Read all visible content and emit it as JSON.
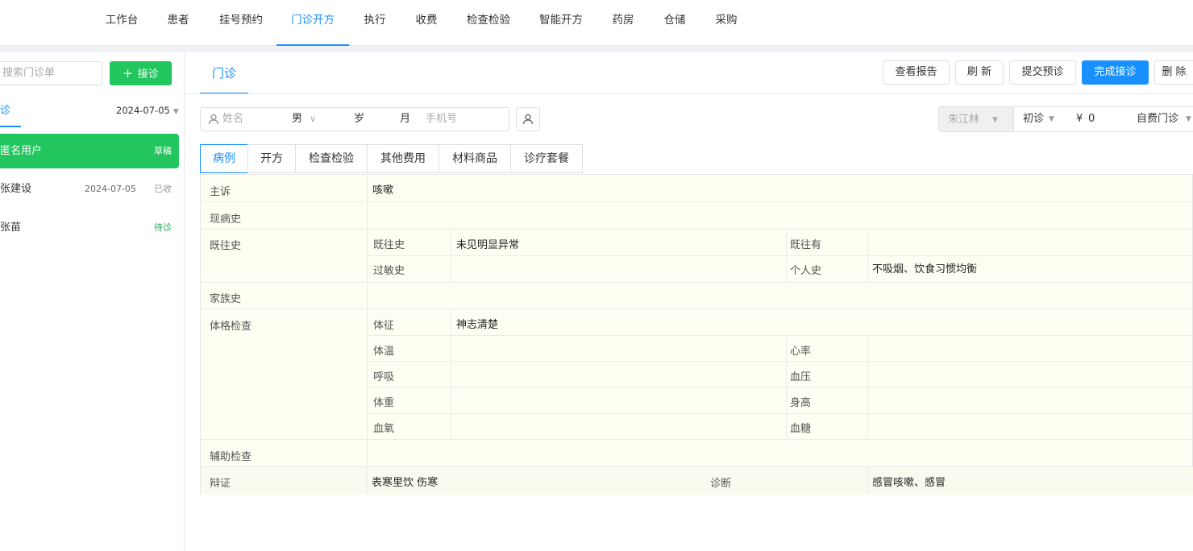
{
  "nav": {
    "items": [
      "工作台",
      "患者",
      "挂号预约",
      "门诊开方",
      "执行",
      "收费",
      "检查检验",
      "智能开方",
      "药房",
      "仓储",
      "采购"
    ],
    "active_index": 3
  },
  "sidebar": {
    "search_placeholder": "搜索门诊单",
    "add_button": "接诊",
    "tab_label": "诊",
    "date_filter": "2024-07-05",
    "patients": [
      {
        "name": "匿名用户",
        "date": "",
        "status": "草稿"
      },
      {
        "name": "张建设",
        "date": "2024-07-05",
        "status": "已收"
      },
      {
        "name": "张苗",
        "date": "",
        "status": "待诊"
      }
    ]
  },
  "main": {
    "tab": "门诊",
    "buttons": {
      "view_report": "查看报告",
      "refresh": "刷 新",
      "submit_prediagnosis": "提交预诊",
      "complete": "完成接诊",
      "delete": "删 除"
    },
    "patient_form": {
      "name_placeholder": "姓名",
      "gender": "男",
      "age_unit": "岁",
      "month_unit": "月",
      "phone_placeholder": "手机号"
    },
    "right_form": {
      "doctor": "朱江林",
      "visit_type": "初诊",
      "currency": "¥",
      "amount": "0",
      "fee_type": "自费门诊"
    },
    "subtabs": [
      "病例",
      "开方",
      "检查检验",
      "其他费用",
      "材料商品",
      "诊疗套餐"
    ],
    "record": {
      "chief_complaint": {
        "label": "主诉",
        "value": "咳嗽"
      },
      "present_illness": {
        "label": "现病史",
        "value": ""
      },
      "past_history": {
        "label": "既往史",
        "past": {
          "label": "既往史",
          "value": "未见明显异常"
        },
        "past_has": {
          "label": "既往有",
          "value": ""
        },
        "allergy": {
          "label": "过敏史",
          "value": ""
        },
        "personal": {
          "label": "个人史",
          "value": "不吸烟、饮食习惯均衡"
        }
      },
      "family_history": {
        "label": "家族史",
        "value": ""
      },
      "physical_exam": {
        "label": "体格检查",
        "signs": {
          "label": "体征",
          "value": "神志清楚"
        },
        "temperature": {
          "label": "体温",
          "value": ""
        },
        "heart_rate": {
          "label": "心率",
          "value": ""
        },
        "respiration": {
          "label": "呼吸",
          "value": ""
        },
        "blood_pressure": {
          "label": "血压",
          "value": ""
        },
        "weight": {
          "label": "体重",
          "value": ""
        },
        "height": {
          "label": "身高",
          "value": ""
        },
        "blood_oxygen": {
          "label": "血氧",
          "value": ""
        },
        "blood_sugar": {
          "label": "血糖",
          "value": ""
        }
      },
      "auxiliary_exam": {
        "label": "辅助检查",
        "value": ""
      },
      "syndrome": {
        "label": "辩证",
        "value": "表寒里饮 伤寒"
      },
      "diagnosis": {
        "label": "诊断",
        "value": "感冒咳嗽、感冒"
      }
    }
  },
  "colors": {
    "primary": "#1890ff",
    "green": "#22c55e",
    "record_bg": "#fffef2"
  }
}
